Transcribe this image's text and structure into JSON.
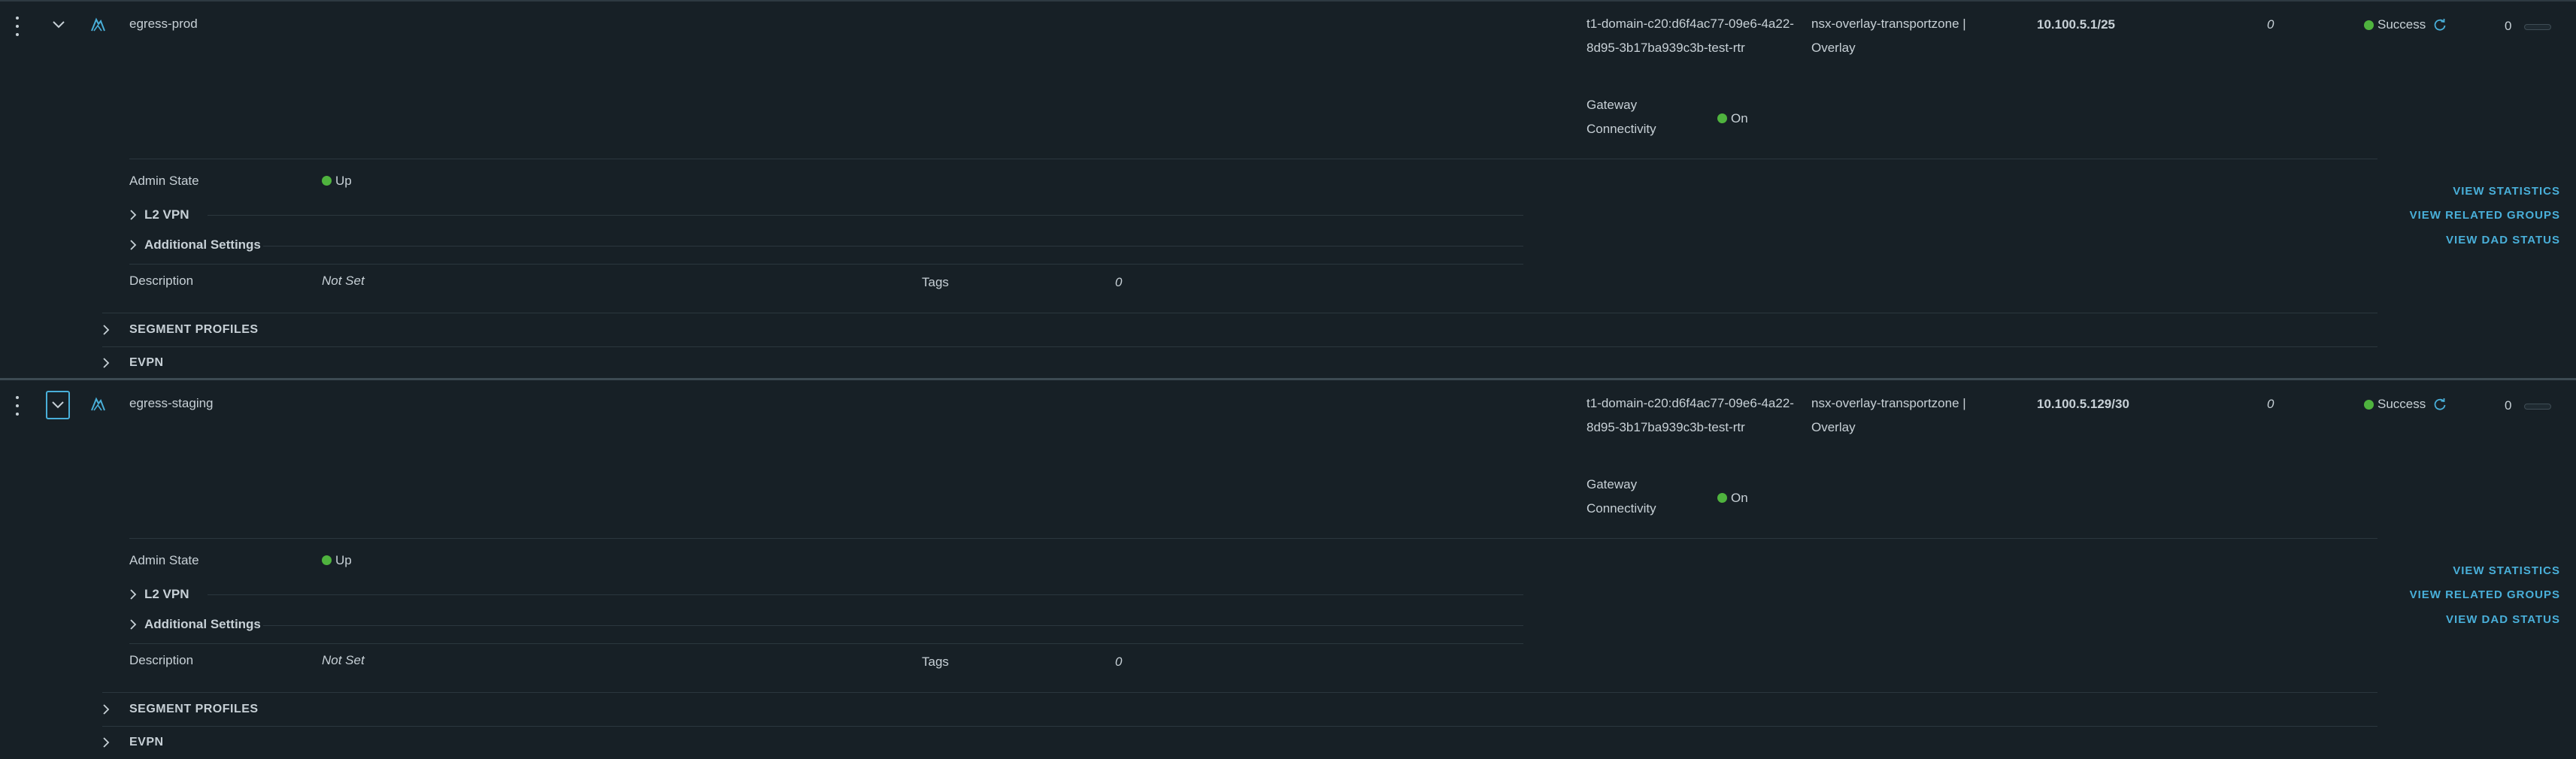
{
  "segments": [
    {
      "name": "egress-prod",
      "gateway": "t1-domain-c20:d6f4ac77-09e6-4a22-8d95-3b17ba939c3b-test-rtr",
      "transport_zone": "nsx-overlay-transportzone | Overlay",
      "subnet": "10.100.5.1/25",
      "ports": "0",
      "status": "Success",
      "count": "0",
      "gateway_connectivity_label": "Gateway Connectivity",
      "gateway_connectivity_value": "On",
      "admin_state_label": "Admin State",
      "admin_state_value": "Up",
      "l2vpn_label": "L2 VPN",
      "additional_settings_label": "Additional Settings",
      "description_label": "Description",
      "description_value": "Not Set",
      "tags_label": "Tags",
      "tags_value": "0",
      "view_statistics": "VIEW STATISTICS",
      "view_related_groups": "VIEW RELATED GROUPS",
      "view_dad_status": "VIEW DAD STATUS",
      "segment_profiles_label": "SEGMENT PROFILES",
      "evpn_label": "EVPN"
    },
    {
      "name": "egress-staging",
      "gateway": "t1-domain-c20:d6f4ac77-09e6-4a22-8d95-3b17ba939c3b-test-rtr",
      "transport_zone": "nsx-overlay-transportzone | Overlay",
      "subnet": "10.100.5.129/30",
      "ports": "0",
      "status": "Success",
      "count": "0",
      "gateway_connectivity_label": "Gateway Connectivity",
      "gateway_connectivity_value": "On",
      "admin_state_label": "Admin State",
      "admin_state_value": "Up",
      "l2vpn_label": "L2 VPN",
      "additional_settings_label": "Additional Settings",
      "description_label": "Description",
      "description_value": "Not Set",
      "tags_label": "Tags",
      "tags_value": "0",
      "view_statistics": "VIEW STATISTICS",
      "view_related_groups": "VIEW RELATED GROUPS",
      "view_dad_status": "VIEW DAD STATUS",
      "segment_profiles_label": "SEGMENT PROFILES",
      "evpn_label": "EVPN"
    }
  ],
  "icons": {
    "row_menu": "kebab-menu-icon",
    "expand": "chevron-down-icon",
    "segment_type": "gateway-segment-icon",
    "refresh": "refresh-icon",
    "collapsed": "chevron-right-icon"
  },
  "colors": {
    "background": "#172026",
    "text": "#c7d0d6",
    "link": "#49afd9",
    "status_green": "#4fb33e",
    "divider": "#2b373e"
  }
}
